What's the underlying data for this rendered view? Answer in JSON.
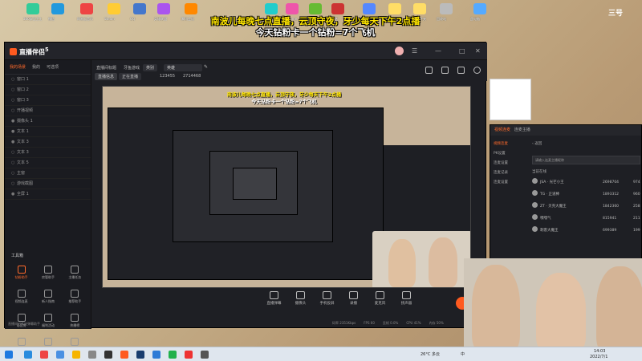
{
  "app": {
    "name": "直播伴侣",
    "version": "5"
  },
  "banner": {
    "line1": "南波儿每晚七点直播，云顶守夜，牙少每天下午2点播",
    "line2": "今天钻粉卡一个钻粉=7个飞机"
  },
  "desktop": {
    "corner_text": "三号",
    "icons": [
      {
        "label": "360安全卫士"
      },
      {
        "label": "微信"
      },
      {
        "label": "网易云音乐"
      },
      {
        "label": "Steam"
      },
      {
        "label": "QQ"
      },
      {
        "label": "英雄联盟"
      },
      {
        "label": "腾讯会议"
      },
      {
        "label": "Chrome"
      },
      {
        "label": "WeGame"
      },
      {
        "label": "TGP"
      },
      {
        "label": "爱奇艺"
      },
      {
        "label": "迅雷"
      },
      {
        "label": "新建文件夹"
      },
      {
        "label": "新建文件夹"
      },
      {
        "label": "回收站"
      },
      {
        "label": "此电脑"
      }
    ]
  },
  "sidebar": {
    "tabs": [
      {
        "label": "我的场景",
        "active": true
      },
      {
        "label": "我的"
      },
      {
        "label": "可选项"
      }
    ],
    "scenes": [
      {
        "label": "窗口 1"
      },
      {
        "label": "窗口 2"
      },
      {
        "label": "窗口 3"
      },
      {
        "label": "开播视频"
      },
      {
        "label": "摄像头 1",
        "visible": true
      },
      {
        "label": "文本 1",
        "visible": true
      },
      {
        "label": "文本 3",
        "visible": true
      },
      {
        "label": "文本 3"
      },
      {
        "label": "文本 5"
      },
      {
        "label": "主窗"
      },
      {
        "label": "游戏截图"
      },
      {
        "label": "全屏 1",
        "visible": true
      }
    ],
    "tools_title": "工具箱",
    "tools": [
      {
        "label": "钻粉助手",
        "hot": true
      },
      {
        "label": "房管助手"
      },
      {
        "label": "主播任务"
      },
      {
        "label": "视频连麦"
      },
      {
        "label": "新人指南"
      },
      {
        "label": "推荐助手"
      },
      {
        "label": "语音房"
      },
      {
        "label": "福利活动"
      },
      {
        "label": "热播榜"
      },
      {
        "label": "分享"
      },
      {
        "label": "数据统计"
      },
      {
        "label": "设置"
      }
    ],
    "notice": "直播间已开启弹幕助手"
  },
  "header": {
    "room_label": "直播间标题",
    "room_title": "牙鱼游戏",
    "category_label": "类别",
    "category": "英雄",
    "tag": "直播信息",
    "tag2": "正在直播",
    "room_id": "123455",
    "viewers": "2714468",
    "edit_icon": "edit-icon"
  },
  "preview": {
    "banner1": "南波儿每晚七点直播，云顶守夜，牙少每天下午2点播",
    "banner2": "今天钻粉卡一个钻粉=7个飞机"
  },
  "bottom_tools": [
    {
      "label": "直播弹幕"
    },
    {
      "label": "摄像头"
    },
    {
      "label": "手机投屏"
    },
    {
      "label": "录播"
    },
    {
      "label": "麦克风"
    },
    {
      "label": "扬声器"
    }
  ],
  "status": {
    "items": [
      "码率 2351Kbps",
      "FPS 60",
      "丢帧 0.0%",
      "CPU 41%",
      "内存 50%"
    ]
  },
  "side_panel": {
    "title": "视频连麦",
    "subtitle": "连麦主播",
    "menu": [
      {
        "label": "视频连麦",
        "active": true
      },
      {
        "label": "PK设置"
      },
      {
        "label": "连麦设置"
      },
      {
        "label": "连麦记录"
      },
      {
        "label": "连麦设置"
      }
    ],
    "back": "返回",
    "search_placeholder": "请输入连麦主播昵称",
    "section": "当前在线",
    "rows": [
      {
        "name": "JSA · 光芒小王",
        "v1": "2698704",
        "v2": "974"
      },
      {
        "name": "TG · 正道棒",
        "v1": "1893312",
        "v2": "960"
      },
      {
        "name": "ZT · 贝壳大魔王",
        "v1": "1842360",
        "v2": "258"
      },
      {
        "name": "嘿嘿气",
        "v1": "815941",
        "v2": "211"
      },
      {
        "name": "刺客大魔王",
        "v1": "699389",
        "v2": "199"
      }
    ]
  },
  "taskbar": {
    "temp": "26°C 多云",
    "ime": "中",
    "time": "14:03",
    "date": "2022/7/1"
  },
  "colors": {
    "accent": "#ff5a1f",
    "banner_yellow": "#ffe600",
    "dark": "#1e1f24"
  }
}
